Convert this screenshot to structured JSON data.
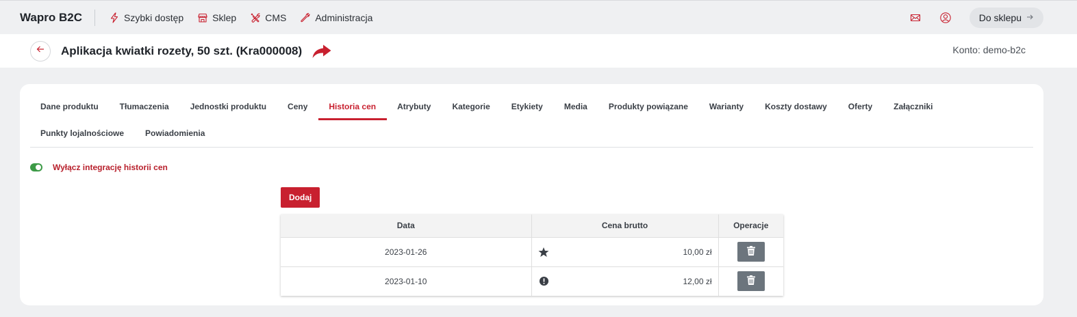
{
  "topbar": {
    "brand": "Wapro B2C",
    "nav": [
      {
        "label": "Szybki dostęp",
        "icon": "lightning-icon"
      },
      {
        "label": "Sklep",
        "icon": "store-icon"
      },
      {
        "label": "CMS",
        "icon": "tools-icon"
      },
      {
        "label": "Administracja",
        "icon": "wrench-icon"
      }
    ],
    "mail_icon": "mail-icon",
    "user_icon": "user-icon",
    "to_shop_label": "Do sklepu"
  },
  "header": {
    "title": "Aplikacja kwiatki rozety, 50 szt. (Kra000008)",
    "account": "Konto: demo-b2c"
  },
  "tabs": [
    {
      "label": "Dane produktu",
      "active": false
    },
    {
      "label": "Tłumaczenia",
      "active": false
    },
    {
      "label": "Jednostki produktu",
      "active": false
    },
    {
      "label": "Ceny",
      "active": false
    },
    {
      "label": "Historia cen",
      "active": true
    },
    {
      "label": "Atrybuty",
      "active": false
    },
    {
      "label": "Kategorie",
      "active": false
    },
    {
      "label": "Etykiety",
      "active": false
    },
    {
      "label": "Media",
      "active": false
    },
    {
      "label": "Produkty powiązane",
      "active": false
    },
    {
      "label": "Warianty",
      "active": false
    },
    {
      "label": "Koszty dostawy",
      "active": false
    },
    {
      "label": "Oferty",
      "active": false
    },
    {
      "label": "Załączniki",
      "active": false
    },
    {
      "label": "Punkty lojalnościowe",
      "active": false
    },
    {
      "label": "Powiadomienia",
      "active": false
    }
  ],
  "integration_toggle": {
    "label": "Wyłącz integrację historii cen",
    "on": true
  },
  "add_button": "Dodaj",
  "table": {
    "columns": [
      "Data",
      "Cena brutto",
      "Operacje"
    ],
    "rows": [
      {
        "date": "2023-01-26",
        "price": "10,00 zł",
        "icon": "star-icon"
      },
      {
        "date": "2023-01-10",
        "price": "12,00 zł",
        "icon": "alert-circle-icon"
      }
    ]
  },
  "colors": {
    "accent": "#c8202f",
    "toggle_on": "#3c9a46",
    "delete_button": "#6c757d"
  }
}
